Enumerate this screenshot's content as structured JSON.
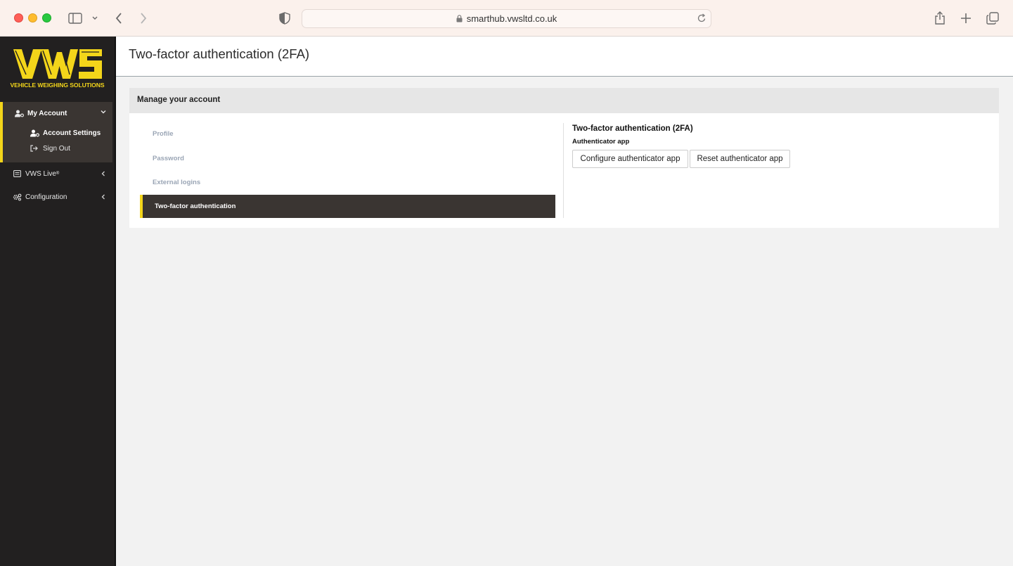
{
  "browser": {
    "url": "smarthub.vwsltd.co.uk"
  },
  "brand": {
    "logo_letters": "VWS",
    "tagline": "VEHICLE WEIGHING SOLUTIONS",
    "accent_color": "#f3d51a"
  },
  "sidebar": {
    "my_account": {
      "label": "My Account",
      "icon": "user-cog-icon",
      "children": [
        {
          "label": "Account Settings",
          "icon": "user-cog-icon",
          "active": true
        },
        {
          "label": "Sign Out",
          "icon": "sign-out-icon"
        }
      ]
    },
    "vws_live": {
      "label": "VWS Live",
      "sup": "®",
      "icon": "list-icon"
    },
    "configuration": {
      "label": "Configuration",
      "icon": "cogs-icon"
    }
  },
  "page": {
    "title": "Two-factor authentication (2FA)"
  },
  "card": {
    "heading": "Manage your account",
    "tabs": [
      "Profile",
      "Password",
      "External logins",
      "Two-factor authentication"
    ],
    "active_tab": "Two-factor authentication",
    "section_title": "Two-factor authentication (2FA)",
    "section_subtitle": "Authenticator app",
    "buttons": {
      "configure": "Configure authenticator app",
      "reset": "Reset authenticator app"
    }
  }
}
